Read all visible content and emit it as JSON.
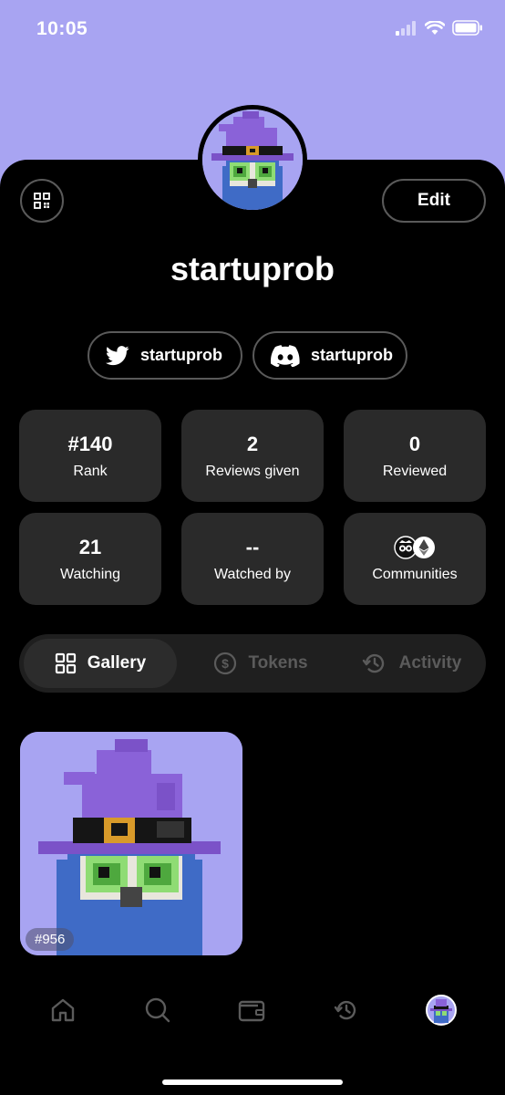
{
  "status": {
    "time": "10:05"
  },
  "profile": {
    "username": "startuprob",
    "edit_label": "Edit"
  },
  "socials": [
    {
      "platform": "twitter",
      "handle": "startuprob"
    },
    {
      "platform": "discord",
      "handle": "startuprob"
    }
  ],
  "stats": [
    {
      "value": "#140",
      "label": "Rank"
    },
    {
      "value": "2",
      "label": "Reviews given"
    },
    {
      "value": "0",
      "label": "Reviewed"
    },
    {
      "value": "21",
      "label": "Watching"
    },
    {
      "value": "--",
      "label": "Watched by"
    },
    {
      "value": "",
      "label": "Communities"
    }
  ],
  "tabs": [
    {
      "label": "Gallery",
      "icon": "grid-icon",
      "active": true
    },
    {
      "label": "Tokens",
      "icon": "dollar-icon",
      "active": false
    },
    {
      "label": "Activity",
      "icon": "history-icon",
      "active": false
    }
  ],
  "gallery": [
    {
      "badge": "#956"
    }
  ],
  "nav": [
    {
      "icon": "home-icon"
    },
    {
      "icon": "search-icon"
    },
    {
      "icon": "wallet-icon"
    },
    {
      "icon": "history-icon"
    },
    {
      "icon": "profile-avatar"
    }
  ],
  "colors": {
    "accent": "#a8a4f2",
    "card": "#2a2a2a",
    "background": "#000000"
  }
}
